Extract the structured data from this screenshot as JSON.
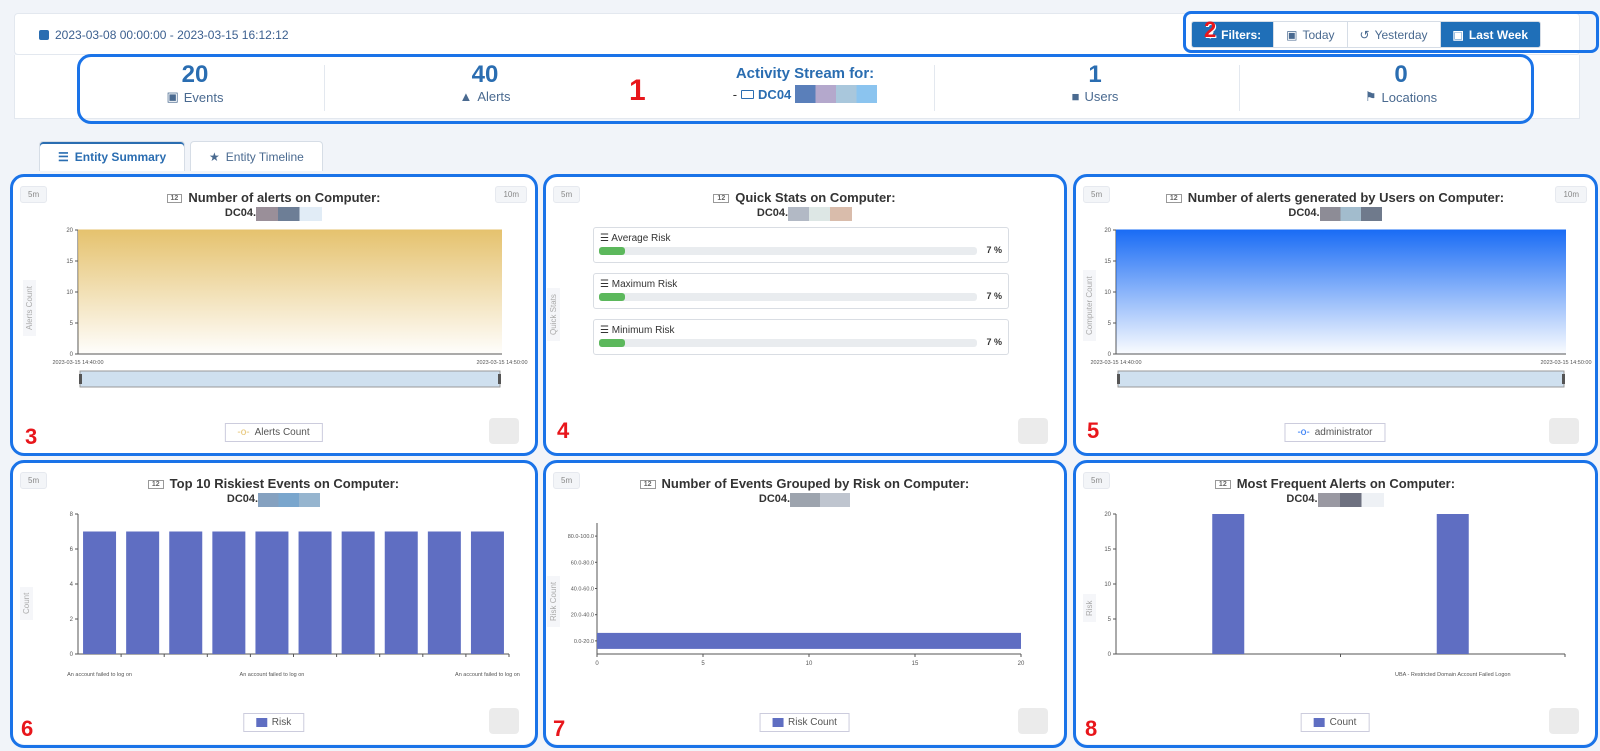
{
  "header": {
    "date_range": "2023-03-08 00:00:00 - 2023-03-15 16:12:12",
    "filters_label": "Filters:",
    "filter_today": "Today",
    "filter_yesterday": "Yesterday",
    "filter_last_week": "Last Week"
  },
  "stats": {
    "events_value": "20",
    "events_label": "Events",
    "alerts_value": "40",
    "alerts_label": "Alerts",
    "stream_title": "Activity Stream for:",
    "stream_prefix": "-",
    "stream_host": "DC04",
    "users_value": "1",
    "users_label": "Users",
    "locations_value": "0",
    "locations_label": "Locations"
  },
  "tabs": {
    "summary": "Entity Summary",
    "timeline": "Entity Timeline"
  },
  "annotations": [
    "1",
    "2",
    "3",
    "4",
    "5",
    "6",
    "7",
    "8"
  ],
  "cards": {
    "alerts_computer": {
      "title": "Number of alerts on Computer:",
      "host": "DC04.",
      "sm": "5m",
      "tenm": "10m",
      "ylabel": "Alerts Count",
      "legend": "Alerts Count"
    },
    "quick_stats": {
      "title": "Quick Stats on Computer:",
      "host": "DC04.",
      "sm": "5m",
      "ylabel": "Quick Stats",
      "items": [
        {
          "label": "Average Risk",
          "pct": "7 %"
        },
        {
          "label": "Maximum Risk",
          "pct": "7 %"
        },
        {
          "label": "Minimum Risk",
          "pct": "7 %"
        }
      ]
    },
    "alerts_users": {
      "title": "Number of alerts generated by Users on Computer:",
      "host": "DC04.",
      "sm": "5m",
      "tenm": "10m",
      "ylabel": "Computer Count",
      "legend": "administrator"
    },
    "riskiest": {
      "title": "Top 10 Riskiest Events on Computer:",
      "host": "DC04.",
      "sm": "5m",
      "ylabel": "Count",
      "legend": "Risk"
    },
    "grouped_risk": {
      "title": "Number of Events Grouped by Risk on Computer:",
      "host": "DC04.",
      "sm": "5m",
      "ylabel": "Risk Count",
      "legend": "Risk Count"
    },
    "frequent": {
      "title": "Most Frequent Alerts on Computer:",
      "host": "DC04.",
      "sm": "5m",
      "ylabel": "Risk",
      "legend": "Count"
    }
  },
  "chart_data": [
    {
      "type": "area",
      "title": "Number of alerts on Computer:",
      "x": [
        "2023-03-15 14:40:00",
        "2023-03-15 14:50:00"
      ],
      "series": [
        {
          "name": "Alerts Count",
          "values": [
            20,
            20
          ]
        }
      ],
      "ylabel": "Alerts Count",
      "ylim": [
        0,
        20
      ],
      "yticks": [
        0,
        5,
        10,
        15,
        20
      ],
      "color": "#e5c26e"
    },
    {
      "type": "area",
      "title": "Number of alerts generated by Users on Computer:",
      "x": [
        "2023-03-15 14:40:00",
        "2023-03-15 14:50:00"
      ],
      "series": [
        {
          "name": "administrator",
          "values": [
            20,
            20
          ]
        }
      ],
      "ylabel": "Computer Count",
      "ylim": [
        0,
        20
      ],
      "yticks": [
        0,
        5,
        10,
        15,
        20
      ],
      "color": "#1a6cf5"
    },
    {
      "type": "bar",
      "title": "Top 10 Riskiest Events on Computer:",
      "categories": [
        "An account failed to log on",
        "",
        "",
        "",
        "An account failed to log on",
        "",
        "",
        "",
        "",
        "An account failed to log on"
      ],
      "series": [
        {
          "name": "Risk",
          "values": [
            7,
            7,
            7,
            7,
            7,
            7,
            7,
            7,
            7,
            7
          ]
        }
      ],
      "ylabel": "Count",
      "ylim": [
        0,
        8
      ],
      "yticks": [
        0,
        2,
        4,
        6,
        8
      ],
      "color": "#5f6ec2"
    },
    {
      "type": "bar",
      "orientation": "horizontal",
      "title": "Number of Events Grouped by Risk on Computer:",
      "categories": [
        "0.0-20.0",
        "20.0-40.0",
        "40.0-60.0",
        "60.0-80.0",
        "80.0-100.0"
      ],
      "series": [
        {
          "name": "Risk Count",
          "values": [
            20,
            0,
            0,
            0,
            0
          ]
        }
      ],
      "ylabel": "Risk Count",
      "xlim": [
        0,
        20
      ],
      "xticks": [
        0,
        5,
        10,
        15,
        20
      ],
      "color": "#5f6ec2"
    },
    {
      "type": "bar",
      "title": "Most Frequent Alerts on Computer:",
      "categories": [
        "",
        "UBA - Restricted Domain Account Failed Logon"
      ],
      "series": [
        {
          "name": "Count",
          "values": [
            20,
            20
          ]
        }
      ],
      "ylabel": "Risk",
      "ylim": [
        0,
        20
      ],
      "yticks": [
        0,
        5,
        10,
        15,
        20
      ],
      "color": "#5f6ec2"
    }
  ]
}
